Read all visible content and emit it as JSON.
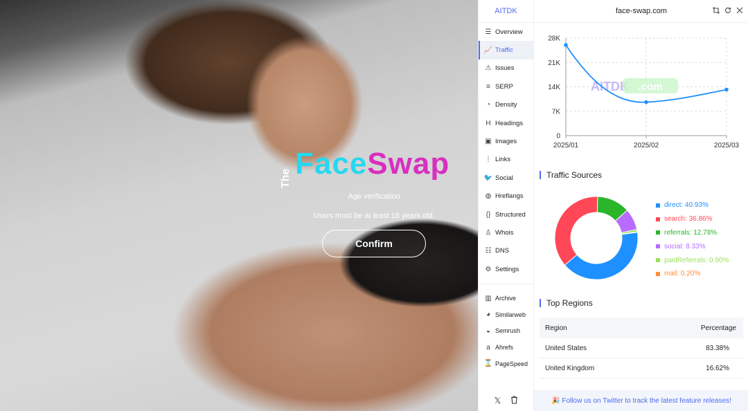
{
  "hero": {
    "logo_the": "The",
    "logo_face": "Face",
    "logo_swap": "Swap",
    "age_title": "Age verification",
    "age_desc": "Users must be at least 18 years old.",
    "confirm_label": "Confirm"
  },
  "panel": {
    "brand": "AITDK",
    "domain": "face-swap.com",
    "nav": [
      {
        "label": "Overview",
        "icon": "list-icon"
      },
      {
        "label": "Traffic",
        "icon": "chart-icon"
      },
      {
        "label": "Issues",
        "icon": "warning-icon"
      },
      {
        "label": "SERP",
        "icon": "serp-icon"
      },
      {
        "label": "Density",
        "icon": "density-icon"
      },
      {
        "label": "Headings",
        "icon": "heading-icon"
      },
      {
        "label": "Images",
        "icon": "image-icon"
      },
      {
        "label": "Links",
        "icon": "links-icon"
      },
      {
        "label": "Social",
        "icon": "bird-icon"
      },
      {
        "label": "Hreflangs",
        "icon": "globe-icon"
      },
      {
        "label": "Structured",
        "icon": "braces-icon"
      },
      {
        "label": "Whois",
        "icon": "user-icon"
      },
      {
        "label": "DNS",
        "icon": "server-icon"
      },
      {
        "label": "Settings",
        "icon": "gear-icon"
      }
    ],
    "ext_links": [
      {
        "label": "Archive",
        "icon": "archive-icon"
      },
      {
        "label": "Similarweb",
        "icon": "similarweb-icon"
      },
      {
        "label": "Semrush",
        "icon": "semrush-icon"
      },
      {
        "label": "Ahrefs",
        "icon": "ahrefs-icon"
      },
      {
        "label": "PageSpeed",
        "icon": "pagespeed-icon"
      }
    ],
    "watermark": "AITDK",
    "watermark_tld": ".com",
    "traffic_sources_title": "Traffic Sources",
    "top_regions_title": "Top Regions",
    "region_header": "Region",
    "percentage_header": "Percentage",
    "regions": [
      {
        "region": "United States",
        "percentage": "83.38%"
      },
      {
        "region": "United Kingdom",
        "percentage": "16.62%"
      }
    ],
    "sources": [
      {
        "label": "direct: 40.93%",
        "value": 40.93,
        "color": "#1e90ff"
      },
      {
        "label": "search: 36.86%",
        "value": 36.86,
        "color": "#ff4757"
      },
      {
        "label": "referrals: 12.78%",
        "value": 12.78,
        "color": "#2ab52a"
      },
      {
        "label": "social: 8.33%",
        "value": 8.33,
        "color": "#b86bff"
      },
      {
        "label": "paidReferrals: 0.90%",
        "value": 0.9,
        "color": "#9be05a"
      },
      {
        "label": "mail: 0.20%",
        "value": 0.2,
        "color": "#ff8c3a"
      }
    ],
    "footer": "🎉 Follow us on Twitter to track the latest feature releases!"
  },
  "chart_data": {
    "type": "line",
    "categories": [
      "2025/01",
      "2025/02",
      "2025/03"
    ],
    "values": [
      26000,
      9600,
      13200
    ],
    "yticks": [
      "28K",
      "21K",
      "14K",
      "7K",
      "0"
    ],
    "ylim": [
      0,
      28000
    ],
    "color": "#1e90ff",
    "grid": true
  }
}
